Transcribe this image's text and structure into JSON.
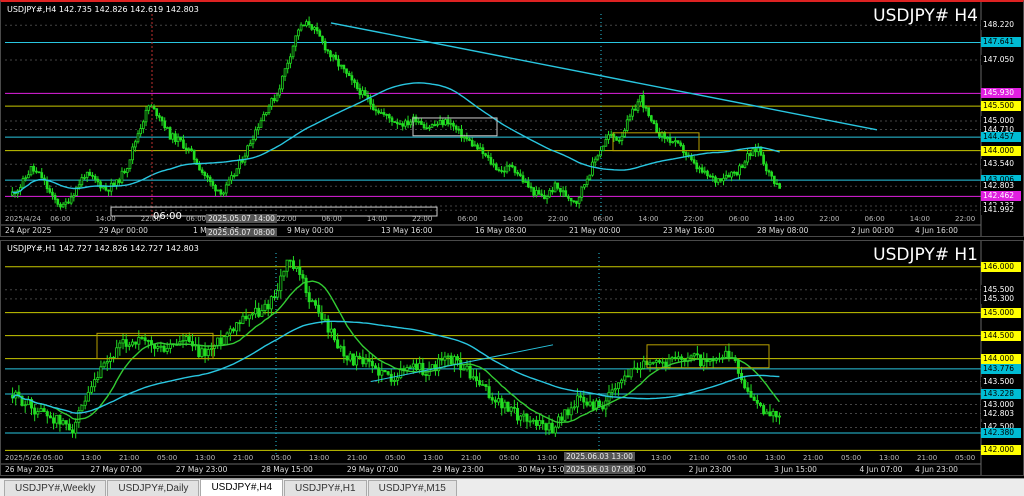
{
  "top_panel": {
    "header": "USDJPY#,H4  142.735 142.826 142.619 142.803",
    "title": "USDJPY# H4",
    "price_labels": [
      {
        "text": "148.220",
        "bg": "#000000",
        "fg": "#ffffff",
        "y": 148.22
      },
      {
        "text": "147.641",
        "bg": "#00bcd4",
        "fg": "#000000",
        "y": 147.641
      },
      {
        "text": "147.050",
        "bg": "#000000",
        "fg": "#ffffff",
        "y": 147.05
      },
      {
        "text": "145.930",
        "bg": "#e020e0",
        "fg": "#ffffff",
        "y": 145.93
      },
      {
        "text": "145.500",
        "bg": "#ffff00",
        "fg": "#000000",
        "y": 145.5
      },
      {
        "text": "145.000",
        "bg": "#000000",
        "fg": "#ffffff",
        "y": 145.0
      },
      {
        "text": "144.710",
        "bg": "#000000",
        "fg": "#ffffff",
        "y": 144.71
      },
      {
        "text": "144.457",
        "bg": "#00bcd4",
        "fg": "#000000",
        "y": 144.457
      },
      {
        "text": "144.000",
        "bg": "#ffff00",
        "fg": "#000000",
        "y": 144.0
      },
      {
        "text": "143.540",
        "bg": "#000000",
        "fg": "#ffffff",
        "y": 143.54
      },
      {
        "text": "143.006",
        "bg": "#00bcd4",
        "fg": "#000000",
        "y": 143.006
      },
      {
        "text": "142.803",
        "bg": "#000000",
        "fg": "#ffffff",
        "y": 142.803
      },
      {
        "text": "142.462",
        "bg": "#e020e0",
        "fg": "#ffffff",
        "y": 142.462
      },
      {
        "text": "142.137",
        "bg": "#000000",
        "fg": "#ffffff",
        "y": 142.137
      },
      {
        "text": "141.992",
        "bg": "#000000",
        "fg": "#ffffff",
        "y": 141.992
      }
    ],
    "time_labels": [
      "24 Apr 2025",
      "29 Apr 00:00",
      "1 May 16:00",
      "9 May 00:00",
      "13 May 16:00",
      "16 May 08:00",
      "21 May 00:00",
      "23 May 16:00",
      "28 May 08:00",
      "2 Jun 00:00",
      "4 Jun 16:00"
    ],
    "inner_time_labels": [
      "2025/4/24",
      "06:00",
      "14:00",
      "22:00",
      "06:00",
      "14:00",
      "22:00",
      "06:00",
      "14:00",
      "22:00",
      "06:00",
      "14:00",
      "22:00",
      "06:00",
      "14:00",
      "22:00",
      "06:00",
      "14:00",
      "22:00",
      "06:00",
      "14:00",
      "22:00"
    ],
    "cursor_time_top": "2025.05.07 14:00",
    "cursor_time_bottom": "2025.05.07 08:00",
    "crosshair_label": "06:00"
  },
  "bottom_panel": {
    "header": "USDJPY#,H1  142.727 142.826 142.727 142.803",
    "title": "USDJPY# H1",
    "price_labels": [
      {
        "text": "146.000",
        "bg": "#ffff00",
        "fg": "#000000",
        "y": 146.0
      },
      {
        "text": "145.500",
        "bg": "#000000",
        "fg": "#ffffff",
        "y": 145.5
      },
      {
        "text": "145.300",
        "bg": "#000000",
        "fg": "#ffffff",
        "y": 145.3
      },
      {
        "text": "145.000",
        "bg": "#ffff00",
        "fg": "#000000",
        "y": 145.0
      },
      {
        "text": "144.500",
        "bg": "#ffff00",
        "fg": "#000000",
        "y": 144.5
      },
      {
        "text": "144.000",
        "bg": "#ffff00",
        "fg": "#000000",
        "y": 144.0
      },
      {
        "text": "143.776",
        "bg": "#00bcd4",
        "fg": "#000000",
        "y": 143.776
      },
      {
        "text": "143.500",
        "bg": "#000000",
        "fg": "#ffffff",
        "y": 143.5
      },
      {
        "text": "143.228",
        "bg": "#00bcd4",
        "fg": "#000000",
        "y": 143.228
      },
      {
        "text": "143.000",
        "bg": "#000000",
        "fg": "#ffffff",
        "y": 143.0
      },
      {
        "text": "142.803",
        "bg": "#000000",
        "fg": "#ffffff",
        "y": 142.803
      },
      {
        "text": "142.500",
        "bg": "#000000",
        "fg": "#ffffff",
        "y": 142.5
      },
      {
        "text": "142.380",
        "bg": "#00bcd4",
        "fg": "#000000",
        "y": 142.38
      },
      {
        "text": "142.000",
        "bg": "#ffff00",
        "fg": "#000000",
        "y": 142.0
      }
    ],
    "time_labels": [
      "26 May 2025",
      "27 May 07:00",
      "27 May 23:00",
      "28 May 15:00",
      "29 May 07:00",
      "29 May 23:00",
      "30 May 15:00",
      "2 Jun 07:00",
      "2 Jun 23:00",
      "3 Jun 15:00",
      "4 Jun 07:00",
      "4 Jun 23:00"
    ],
    "inner_time_labels": [
      "2025/5/26",
      "05:00",
      "13:00",
      "21:00",
      "05:00",
      "13:00",
      "21:00",
      "05:00",
      "13:00",
      "21:00",
      "05:00",
      "13:00",
      "21:00",
      "05:00",
      "13:00",
      "21:00",
      "05:00",
      "13:00",
      "21:00",
      "05:00",
      "13:00",
      "21:00",
      "05:00",
      "13:00",
      "21:00",
      "05:00"
    ],
    "cursor_time_top": "2025.06.03 13:00",
    "cursor_time_bottom": "2025.06.03 07:00"
  },
  "tabs": [
    {
      "label": "USDJPY#,Weekly",
      "active": false
    },
    {
      "label": "USDJPY#,Daily",
      "active": false
    },
    {
      "label": "USDJPY#,H4",
      "active": true
    },
    {
      "label": "USDJPY#,H1",
      "active": false
    },
    {
      "label": "USDJPY#,M15",
      "active": false
    }
  ],
  "colors": {
    "candle": "#22dd22",
    "ma_cyan": "#29c6e0",
    "ma_green": "#33cc33",
    "trendline": "#29c6e0",
    "hline_yellow": "#c8c800",
    "hline_cyan": "#29c6e0",
    "hline_magenta": "#e020e0",
    "box": "#b8a000"
  },
  "chart_data": [
    {
      "type": "candlestick",
      "title": "USDJPY# H4",
      "ylim": [
        141.8,
        148.6
      ],
      "close_path": [
        142.5,
        142.8,
        143.4,
        143.1,
        142.4,
        142.1,
        142.6,
        143.2,
        143.0,
        142.7,
        142.9,
        143.5,
        144.6,
        145.5,
        145.2,
        144.5,
        144.3,
        143.9,
        143.3,
        142.8,
        142.6,
        143.2,
        143.9,
        144.7,
        145.4,
        145.9,
        147.0,
        148.1,
        148.3,
        147.8,
        147.2,
        146.8,
        146.3,
        145.9,
        145.5,
        145.2,
        145.0,
        144.9,
        145.1,
        144.8,
        144.9,
        145.0,
        144.6,
        144.3,
        144.0,
        143.6,
        143.3,
        143.5,
        143.0,
        142.6,
        142.4,
        142.8,
        142.5,
        142.3,
        143.1,
        143.9,
        144.5,
        144.4,
        145.1,
        145.8,
        144.9,
        144.5,
        144.3,
        144.0,
        143.5,
        143.2,
        143.0,
        143.2,
        143.3,
        143.8,
        144.1,
        143.2,
        142.8
      ]
    },
    {
      "type": "candlestick",
      "title": "USDJPY# H1",
      "ylim": [
        141.9,
        146.3
      ],
      "close_path": [
        143.2,
        143.1,
        142.9,
        142.8,
        142.6,
        142.5,
        143.0,
        143.6,
        144.0,
        144.3,
        144.4,
        144.3,
        144.2,
        144.3,
        144.4,
        144.1,
        144.2,
        144.5,
        144.8,
        145.0,
        145.0,
        145.4,
        146.1,
        145.8,
        145.2,
        144.8,
        144.3,
        144.0,
        143.9,
        143.8,
        143.6,
        143.7,
        143.9,
        143.7,
        143.9,
        144.0,
        143.8,
        143.5,
        143.2,
        143.0,
        142.8,
        142.7,
        142.6,
        142.5,
        142.8,
        143.1,
        143.0,
        143.0,
        143.3,
        143.7,
        143.9,
        144.0,
        143.9,
        144.0,
        144.1,
        143.9,
        143.9,
        144.1,
        143.6,
        143.0,
        142.8,
        142.8
      ]
    }
  ]
}
